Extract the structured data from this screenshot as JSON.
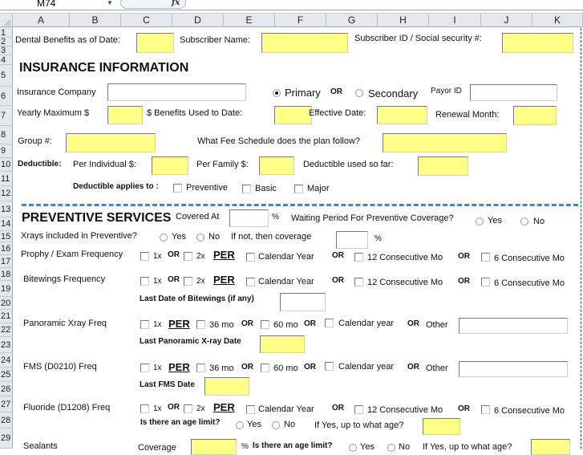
{
  "formula_bar": {
    "name_box": "M74",
    "fx": "fx"
  },
  "columns": [
    "A",
    "B",
    "C",
    "D",
    "E",
    "F",
    "G",
    "H",
    "I",
    "J",
    "K"
  ],
  "rows": [
    "1",
    "2",
    "3",
    "4",
    "5",
    "6",
    "7",
    "8",
    "9",
    "10",
    "11",
    "12",
    "13",
    "14",
    "15",
    "16",
    "17",
    "18",
    "19",
    "20",
    "21",
    "22",
    "23",
    "24",
    "25",
    "26",
    "27",
    "28",
    "29"
  ],
  "header": {
    "benefits_date_label": "Dental Benefits as of Date:",
    "subscriber_name_label": "Subscriber Name:",
    "subscriber_id_label": "Subscriber ID / Social security #:"
  },
  "insurance": {
    "title": "INSURANCE INFORMATION",
    "company_label": "Insurance Company",
    "primary_label": "Primary",
    "or": "OR",
    "secondary_label": "Secondary",
    "payor_id_label": "Payor ID",
    "primary_selected": true,
    "yearly_max_label": "Yearly Maximum $",
    "benefits_used_label": "$ Benefits Used to Date:",
    "effective_date_label": "Effective Date:",
    "renewal_month_label": "Renewal Month:",
    "group_label": "Group #:",
    "fee_schedule_label": "What Fee Schedule does the plan follow?",
    "deductible_label": "Deductible:",
    "per_individual_label": "Per Individual $:",
    "per_family_label": "Per Family $:",
    "deductible_used_label": "Deductible used so far:",
    "applies_to_label": "Deductible applies to :",
    "applies_options": [
      "Preventive",
      "Basic",
      "Major"
    ]
  },
  "preventive": {
    "title": "PREVENTIVE SERVICES",
    "covered_at_label": "Covered At",
    "percent": "%",
    "waiting_label": "Waiting Period For Preventive Coverage?",
    "yes": "Yes",
    "no": "No",
    "xrays_label": "Xrays included in Preventive?",
    "if_not_label": "If not, then coverage",
    "or": "OR",
    "per": "PER",
    "x1": "1x",
    "x2": "2x",
    "calendar_year": "Calendar Year",
    "calendar_year_lc": "Calendar year",
    "consec12": "12 Consecutive Mo",
    "consec6": "6 Consecutive Mo",
    "mo36": "36 mo",
    "mo60": "60 mo",
    "other": "Other",
    "prophy_label": "Prophy / Exam Frequency",
    "bitewings_label": "Bitewings Frequency",
    "last_bitewings_label": "Last Date of Bitewings (if any)",
    "pano_label": "Panoramic Xray Freq",
    "last_pano_label": "Last Panoramic X-ray Date",
    "fms_label": "FMS (D0210) Freq",
    "last_fms_label": "Last FMS Date",
    "fluoride_label": "Fluoride (D1208) Freq",
    "age_limit_label": "Is there an age limit?",
    "up_to_age_label": "If Yes, up to what age?",
    "sealants_label": "Sealants",
    "coverage_label": "Coverage"
  }
}
